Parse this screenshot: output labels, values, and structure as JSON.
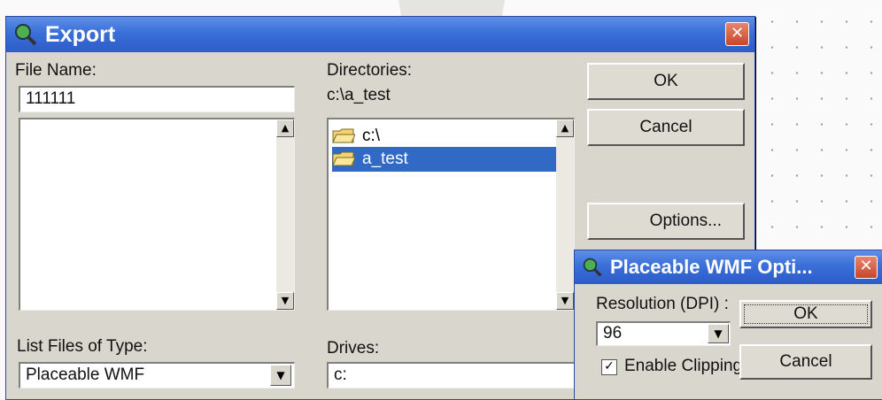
{
  "export_dialog": {
    "title": "Export",
    "file_name_label": "File Name:",
    "file_name_value": "111111",
    "directories_label": "Directories:",
    "current_dir": "c:\\a_test",
    "directories": [
      {
        "name": "c:\\",
        "selected": false
      },
      {
        "name": "a_test",
        "selected": true
      }
    ],
    "list_files_label": "List Files of Type:",
    "file_type_value": "Placeable WMF",
    "drives_label": "Drives:",
    "drive_value": "c:",
    "ok_label": "OK",
    "cancel_label": "Cancel",
    "options_label": "Options...",
    "close_glyph": "✕"
  },
  "wmf_dialog": {
    "title": "Placeable WMF Opti...",
    "resolution_label": "Resolution (DPI) :",
    "resolution_value": "96",
    "enable_clipping_label": "Enable Clipping",
    "enable_clipping_checked": true,
    "check_glyph": "✓",
    "ok_label": "OK",
    "cancel_label": "Cancel",
    "close_glyph": "✕"
  },
  "icons": {
    "title_icon": "magnifier-globe-icon",
    "folder_icon": "folder-open-icon",
    "scroll_up": "▲",
    "scroll_down": "▼",
    "combo_arrow": "▼"
  },
  "colors": {
    "titlebar": "#3a6fd8",
    "selection": "#316ac5",
    "watermark": "#e0703a"
  }
}
